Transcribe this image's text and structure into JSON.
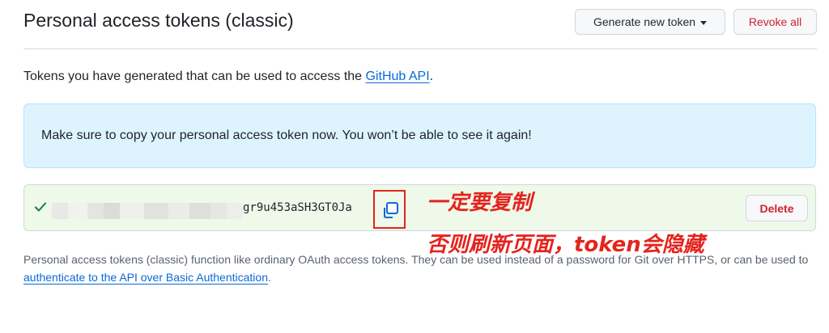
{
  "header": {
    "title": "Personal access tokens (classic)",
    "generate_button_label": "Generate new token",
    "revoke_all_label": "Revoke all"
  },
  "intro": {
    "text_before_link": "Tokens you have generated that can be used to access the ",
    "link_text": "GitHub API",
    "text_after_link": "."
  },
  "flash": {
    "message": "Make sure to copy your personal access token now. You won’t be able to see it again!"
  },
  "token": {
    "visible_value": "gr9u453aSH3GT0Ja",
    "delete_label": "Delete",
    "status_icon": "check-icon",
    "copy_icon": "copy-icon"
  },
  "annotations": {
    "line1": "一定要复制",
    "line2": "否则刷新页面，token会隐藏"
  },
  "footer": {
    "text_before_link": "Personal access tokens (classic) function like ordinary OAuth access tokens. They can be used instead of a password for Git over HTTPS, or can be used to ",
    "link_text": "authenticate to the API over Basic Authentication",
    "text_after_link": "."
  },
  "colors": {
    "accent_link": "#0969da",
    "danger": "#cf222e",
    "flash_bg": "#ddf4ff",
    "token_row_bg": "#eef9ea",
    "annotation_red": "#e5231d"
  }
}
